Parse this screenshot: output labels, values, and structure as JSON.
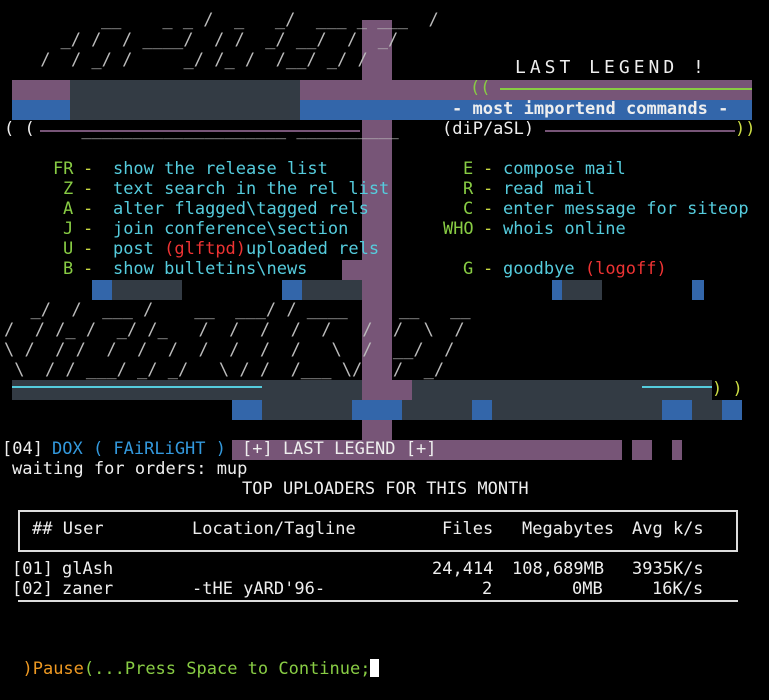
{
  "logo_text": "LAST LEGEND !",
  "header": {
    "commands_title": "- most importend commands -",
    "credit": "(diP/aSL)"
  },
  "commands_left": [
    {
      "key": "FR",
      "sep": "-",
      "desc": "show the release list"
    },
    {
      "key": "Z",
      "sep": "-",
      "desc": "text search in the rel list"
    },
    {
      "key": "A",
      "sep": "-",
      "desc": "alter flagged\\tagged rels"
    },
    {
      "key": "J",
      "sep": "-",
      "desc": "join conference\\section"
    },
    {
      "key": "U",
      "sep": "-",
      "desc_pre": "post ",
      "desc_red": "(glftpd)",
      "desc_post": "uploaded rels"
    },
    {
      "key": "B",
      "sep": "-",
      "desc": "show bulletins\\news"
    }
  ],
  "commands_right": [
    {
      "key": "E",
      "sep": "-",
      "desc": "compose mail"
    },
    {
      "key": "R",
      "sep": "-",
      "desc": "read mail"
    },
    {
      "key": "C",
      "sep": "-",
      "desc": "enter message for siteop"
    },
    {
      "key": "WHO",
      "sep": "-",
      "desc": "whois online"
    },
    {
      "key": "G",
      "sep": "-",
      "desc_pre": "goodbye ",
      "desc_red": "(logoff)"
    }
  ],
  "status": {
    "node": "[04]",
    "user": "DOX ( FAiRLiGHT )",
    "site": "[+] LAST LEGEND [+]",
    "prompt": "waiting for orders: mup"
  },
  "uploaders": {
    "title": "TOP UPLOADERS FOR THIS MONTH",
    "columns": [
      "## User",
      "Location/Tagline",
      "Files",
      "Megabytes",
      "Avg k/s"
    ],
    "rows": [
      {
        "rank": "[01]",
        "user": "glAsh",
        "tagline": "",
        "files": "24,414",
        "mb": "108,689MB",
        "avg": "3935K/s"
      },
      {
        "rank": "[02]",
        "user": "zaner",
        "tagline": "-tHE yARD'96-",
        "files": "2",
        "mb": "0MB",
        "avg": "16K/s"
      }
    ]
  },
  "pause": {
    "label": ")Pause",
    "message": "(...Press Space to Continue;"
  },
  "colors": {
    "purple": "#775577",
    "blue": "#3366aa",
    "slate": "#333b44",
    "green": "#88cc44",
    "cyan": "#55ccdd",
    "red": "#ee3333",
    "orange": "#ee9922"
  }
}
